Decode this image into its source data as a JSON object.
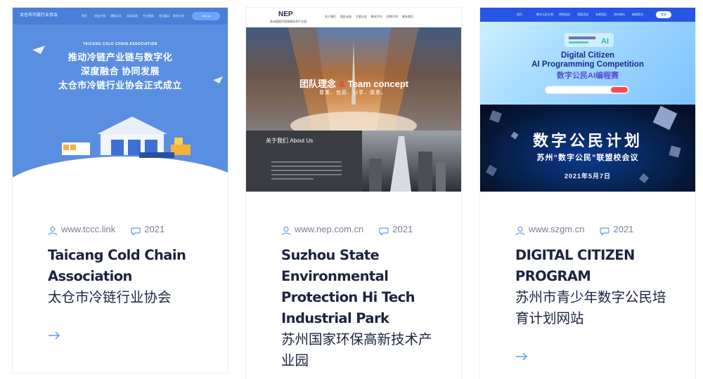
{
  "cards": [
    {
      "url": "www.tccc.link",
      "year": "2021",
      "title_en": "Taicang Cold Chain Association",
      "title_cn": "太仓市冷链行业协会",
      "thumbnail": {
        "logo": "太仓市冷链行业协会",
        "nav": [
          "首页",
          "协会介绍",
          "通知公告",
          "活动动态",
          "专业服务",
          "会员展示",
          "联系方式"
        ],
        "button": "Join us",
        "subtitle": "TAICANG COLD CHAIN ASSOCIATION",
        "headline": [
          "推动冷链产业链与数字化",
          "深度融合 协同发展",
          "太仓市冷链行业协会正式成立"
        ]
      }
    },
    {
      "url": "www.nep.com.cn",
      "year": "2021",
      "title_en": "Suzhou State Environmental Protection Hi Tech Industrial Park",
      "title_cn": "苏州国家环保高新技术产业园",
      "thumbnail": {
        "logo": "NEP",
        "logo_sub": "苏州国家环保高新技术产业园",
        "nav": [
          "关于我们",
          "园区动态",
          "主要业务",
          "孵化平台",
          "招商引资",
          "联系我们"
        ],
        "slogan_cn": "团队理念",
        "slogan_amp": "&",
        "slogan_en": "Team concept",
        "slogan_sub": "尊重、包容、分享、感恩。",
        "about_title": "关于我们 About Us"
      }
    },
    {
      "url": "www.szgm.cn",
      "year": "2021",
      "title_en": "DIGITAL CITIZEN PROGRAM",
      "title_cn": "苏州市青少年数字公民培育计划网站",
      "thumbnail": {
        "nav": [
          "首页",
          "数字公民计划",
          "师资培训",
          "竞赛活动",
          "名师团队",
          "合作单位",
          "新闻资讯"
        ],
        "login": "登录",
        "line1": "Digital Citizen",
        "line2": "AI Programming Competition",
        "line3": "数字公民AI编程赛",
        "banner1": "数字公民计划",
        "banner2": "苏州“数字公民”联盟校会议",
        "banner3": "2021年5月7日"
      }
    }
  ],
  "icons": {
    "meta_url": "user-icon",
    "meta_year": "comment-icon",
    "link": "arrow-right-icon"
  },
  "colors": {
    "title": "#1d2440",
    "meta": "#7b8093",
    "accent": "#5f9bf0"
  }
}
